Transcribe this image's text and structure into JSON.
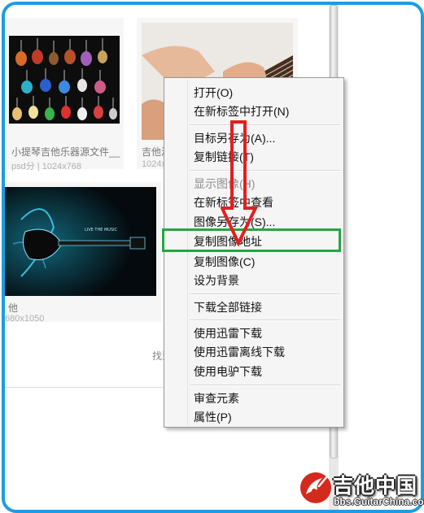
{
  "gallery": {
    "items": [
      {
        "caption": "小提琴吉他乐器源文件__",
        "meta": "psd分 | 1024x768"
      },
      {
        "caption": "吉他演",
        "meta": "1024x"
      },
      {
        "caption": "他",
        "meta": "680x1050"
      }
    ],
    "footer_text": "找到"
  },
  "context_menu": {
    "items": [
      {
        "label": "打开(O)",
        "enabled": true
      },
      {
        "label": "在新标签中打开(N)",
        "enabled": true
      },
      {
        "label": "目标另存为(A)...",
        "enabled": true
      },
      {
        "label": "复制链接(T)",
        "enabled": true
      },
      {
        "label": "显示图像(H)",
        "enabled": false
      },
      {
        "label": "在新标签中查看",
        "enabled": true
      },
      {
        "label": "图像另存为(S)...",
        "enabled": true
      },
      {
        "label": "复制图像地址",
        "enabled": true,
        "highlighted": true
      },
      {
        "label": "复制图像(C)",
        "enabled": true
      },
      {
        "label": "设为背景",
        "enabled": true
      },
      {
        "label": "下载全部链接",
        "enabled": true
      },
      {
        "label": "使用迅雷下载",
        "enabled": true
      },
      {
        "label": "使用迅雷离线下载",
        "enabled": true
      },
      {
        "label": "使用电驴下载",
        "enabled": true
      },
      {
        "label": "审查元素",
        "enabled": true
      },
      {
        "label": "属性(P)",
        "enabled": true
      }
    ]
  },
  "watermark": {
    "title": "吉他中国",
    "url": "bbs.GuitarChina.com"
  },
  "colors": {
    "frame_border": "#1e9ce0",
    "highlight_box": "#24a640",
    "arrow": "#e02020"
  },
  "icons": [
    "guitar-logo-icon",
    "down-arrow-icon"
  ]
}
